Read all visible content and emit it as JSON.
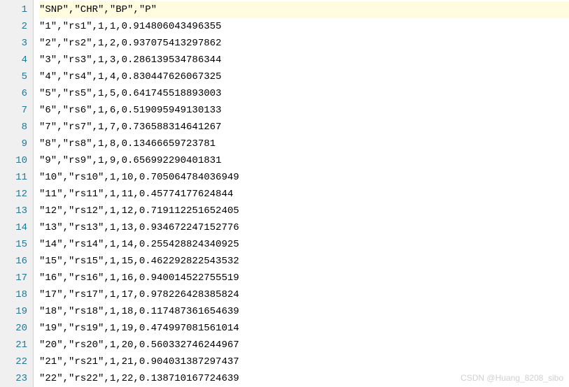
{
  "lines": [
    {
      "num": 1,
      "text": "\"SNP\",\"CHR\",\"BP\",\"P\"",
      "highlighted": true
    },
    {
      "num": 2,
      "text": "\"1\",\"rs1\",1,1,0.914806043496355",
      "highlighted": false
    },
    {
      "num": 3,
      "text": "\"2\",\"rs2\",1,2,0.937075413297862",
      "highlighted": false
    },
    {
      "num": 4,
      "text": "\"3\",\"rs3\",1,3,0.286139534786344",
      "highlighted": false
    },
    {
      "num": 5,
      "text": "\"4\",\"rs4\",1,4,0.830447626067325",
      "highlighted": false
    },
    {
      "num": 6,
      "text": "\"5\",\"rs5\",1,5,0.641745518893003",
      "highlighted": false
    },
    {
      "num": 7,
      "text": "\"6\",\"rs6\",1,6,0.519095949130133",
      "highlighted": false
    },
    {
      "num": 8,
      "text": "\"7\",\"rs7\",1,7,0.736588314641267",
      "highlighted": false
    },
    {
      "num": 9,
      "text": "\"8\",\"rs8\",1,8,0.13466659723781",
      "highlighted": false
    },
    {
      "num": 10,
      "text": "\"9\",\"rs9\",1,9,0.656992290401831",
      "highlighted": false
    },
    {
      "num": 11,
      "text": "\"10\",\"rs10\",1,10,0.705064784036949",
      "highlighted": false
    },
    {
      "num": 12,
      "text": "\"11\",\"rs11\",1,11,0.45774177624844",
      "highlighted": false
    },
    {
      "num": 13,
      "text": "\"12\",\"rs12\",1,12,0.719112251652405",
      "highlighted": false
    },
    {
      "num": 14,
      "text": "\"13\",\"rs13\",1,13,0.934672247152776",
      "highlighted": false
    },
    {
      "num": 15,
      "text": "\"14\",\"rs14\",1,14,0.255428824340925",
      "highlighted": false
    },
    {
      "num": 16,
      "text": "\"15\",\"rs15\",1,15,0.462292822543532",
      "highlighted": false
    },
    {
      "num": 17,
      "text": "\"16\",\"rs16\",1,16,0.940014522755519",
      "highlighted": false
    },
    {
      "num": 18,
      "text": "\"17\",\"rs17\",1,17,0.978226428385824",
      "highlighted": false
    },
    {
      "num": 19,
      "text": "\"18\",\"rs18\",1,18,0.117487361654639",
      "highlighted": false
    },
    {
      "num": 20,
      "text": "\"19\",\"rs19\",1,19,0.474997081561014",
      "highlighted": false
    },
    {
      "num": 21,
      "text": "\"20\",\"rs20\",1,20,0.560332746244967",
      "highlighted": false
    },
    {
      "num": 22,
      "text": "\"21\",\"rs21\",1,21,0.904031387297437",
      "highlighted": false
    },
    {
      "num": 23,
      "text": "\"22\",\"rs22\",1,22,0.138710167724639",
      "highlighted": false
    }
  ],
  "watermark": "CSDN @Huang_8208_sibo"
}
